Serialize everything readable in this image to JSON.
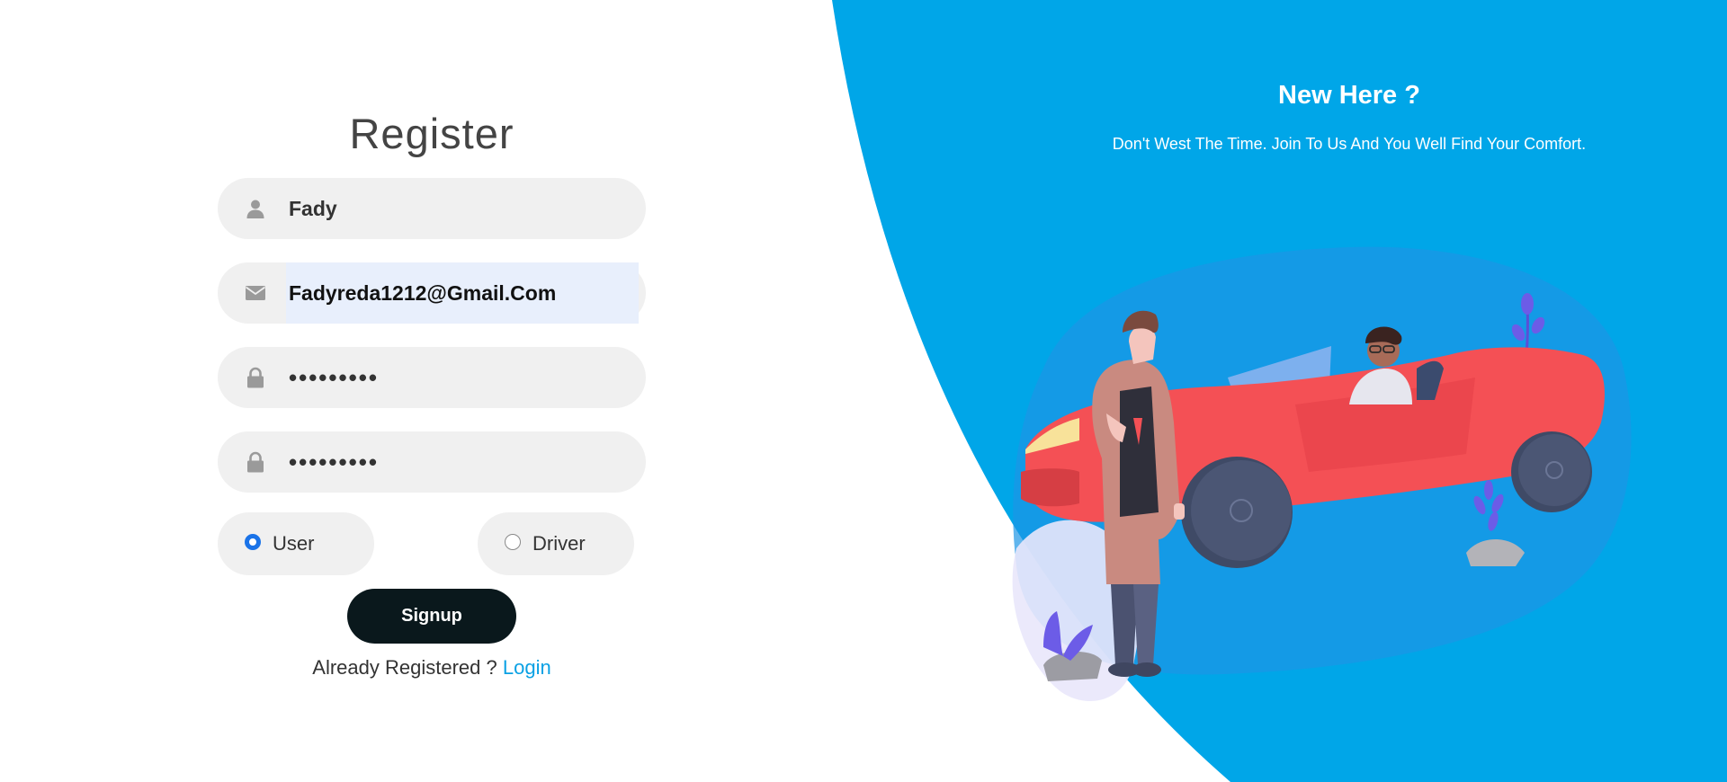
{
  "form": {
    "title": "Register",
    "name_value": "Fady",
    "email_value": "Fadyreda1212@Gmail.Com",
    "password_mask": "•••••••••",
    "confirm_password_mask": "•••••••••",
    "roles": [
      {
        "label": "User",
        "selected": true
      },
      {
        "label": "Driver",
        "selected": false
      }
    ],
    "signup_label": "Signup",
    "already_text": "Already Registered ?",
    "login_label": "Login"
  },
  "panel": {
    "title": "New Here ?",
    "subtitle": "Don't West The Time. Join To Us And You Well Find Your Comfort."
  },
  "colors": {
    "panel_blue": "#00a6e8",
    "accent_link": "#0aa1e4",
    "button_dark": "#0a181c",
    "field_bg": "#f0f0f0",
    "autofill_bg": "#e8effc",
    "radio_selected": "#1a73e8",
    "car_red": "#f45055"
  },
  "icons": {
    "name_field": "user-icon",
    "email_field": "envelope-icon",
    "password_field": "lock-icon",
    "confirm_field": "lock-icon"
  }
}
